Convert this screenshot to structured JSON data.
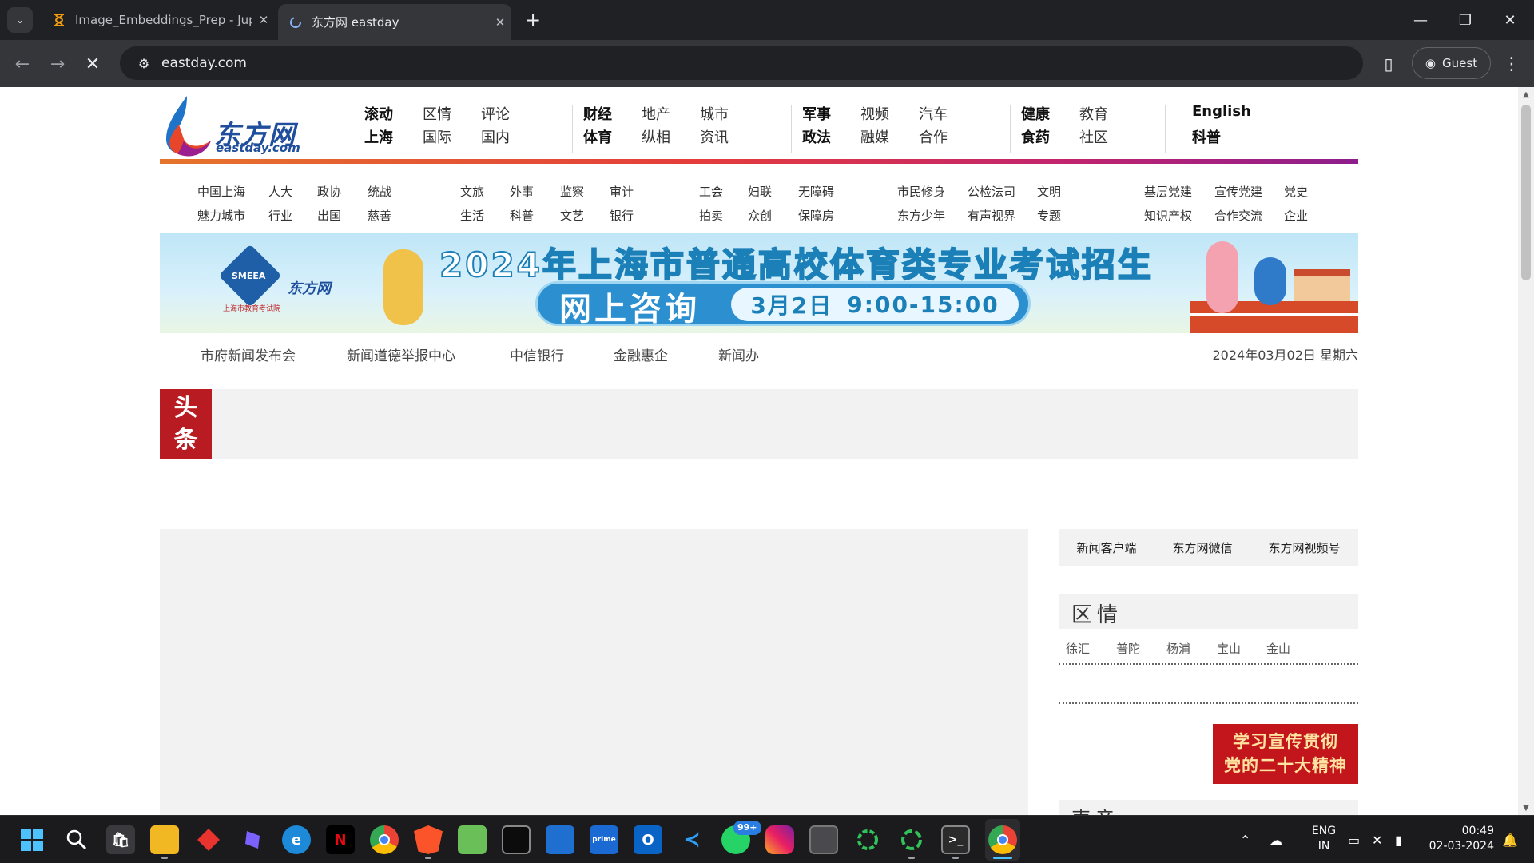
{
  "browser": {
    "tabs": [
      {
        "title": "Image_Embeddings_Prep - Jupyter",
        "active": false,
        "favicon": "hourglass-icon"
      },
      {
        "title": "东方网 eastday",
        "active": true,
        "favicon": "loading-spinner-icon"
      }
    ],
    "url": "eastday.com",
    "profile_label": "Guest"
  },
  "site": {
    "logo_cn": "东方网",
    "logo_en": "eastday.com",
    "top_nav": [
      {
        "top": "滚动",
        "bottom": "上海",
        "bold": true
      },
      {
        "top": "区情",
        "bottom": "国际",
        "bold": false
      },
      {
        "top": "评论",
        "bottom": "国内",
        "bold": false
      },
      {
        "top": "财经",
        "bottom": "体育",
        "bold": true
      },
      {
        "top": "地产",
        "bottom": "纵相",
        "bold": false
      },
      {
        "top": "城市",
        "bottom": "资讯",
        "bold": false
      },
      {
        "top": "军事",
        "bottom": "政法",
        "bold": true
      },
      {
        "top": "视频",
        "bottom": "融媒",
        "bold": false
      },
      {
        "top": "汽车",
        "bottom": "合作",
        "bold": false
      },
      {
        "top": "健康",
        "bottom": "食药",
        "bold": true
      },
      {
        "top": "教育",
        "bottom": "社区",
        "bold": false
      },
      {
        "top": "English",
        "bottom": "科普",
        "bold": true
      }
    ],
    "sub_nav": [
      {
        "top": "中国上海",
        "bottom": "魅力城市"
      },
      {
        "top": "人大",
        "bottom": "行业"
      },
      {
        "top": "政协",
        "bottom": "出国"
      },
      {
        "top": "统战",
        "bottom": "慈善"
      },
      {
        "top": "文旅",
        "bottom": "生活"
      },
      {
        "top": "外事",
        "bottom": "科普"
      },
      {
        "top": "监察",
        "bottom": "文艺"
      },
      {
        "top": "审计",
        "bottom": "银行"
      },
      {
        "top": "工会",
        "bottom": "拍卖"
      },
      {
        "top": "妇联",
        "bottom": "众创"
      },
      {
        "top": "无障碍",
        "bottom": "保障房"
      },
      {
        "top": "市民修身",
        "bottom": "东方少年"
      },
      {
        "top": "公检法司",
        "bottom": "有声视界"
      },
      {
        "top": "文明",
        "bottom": "专题"
      },
      {
        "top": "基层党建",
        "bottom": "知识产权"
      },
      {
        "top": "宣传党建",
        "bottom": "合作交流"
      },
      {
        "top": "党史",
        "bottom": "企业"
      }
    ],
    "banner": {
      "title": "2024年上海市普通高校体育类专业考试招生",
      "consult": "网上咨询",
      "date": "3月2日",
      "time": "9:00-15:00",
      "seal_text": "上海市教育考试院",
      "seal_abbr": "SMEEA",
      "mini_logo": "东方网"
    },
    "info_links": [
      "市府新闻发布会",
      "新闻道德举报中心",
      "中信银行",
      "金融惠企",
      "新闻办"
    ],
    "date_text": "2024年03月02日  星期六",
    "headline_badge": "头 条",
    "sidebar": {
      "top_links": [
        "新闻客户端",
        "东方网微信",
        "东方网视频号"
      ],
      "region_title": "区情",
      "region_links": [
        "徐汇",
        "普陀",
        "杨浦",
        "宝山",
        "金山"
      ],
      "promo_line1": "学习宣传贯彻",
      "promo_line2": "党的二十大精神",
      "next_title": "声音"
    }
  },
  "taskbar": {
    "apps": [
      "windows-start-icon",
      "search-icon",
      "store-icon",
      "file-explorer-icon",
      "app-red-diamond-icon",
      "copilot-icon",
      "edge-icon",
      "netflix-icon",
      "chrome-icon",
      "brave-icon",
      "paint-icon",
      "terminal-icon",
      "app-blue-icon",
      "prime-video-icon",
      "outlook-icon",
      "vscode-icon",
      "whatsapp-icon",
      "instagram-icon",
      "app-window-icon",
      "app-green-ring-icon",
      "app-green-ring-2-icon",
      "powershell-icon",
      "chrome-active-icon"
    ],
    "whatsapp_badge": "99+",
    "lang_line1": "ENG",
    "lang_line2": "IN",
    "time": "00:49",
    "date": "02-03-2024"
  }
}
